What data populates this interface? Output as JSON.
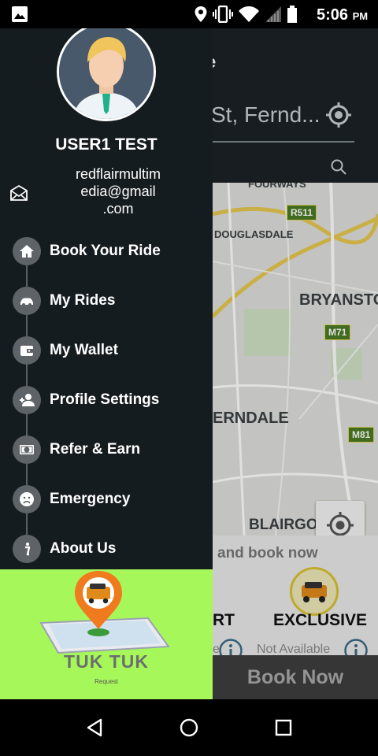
{
  "status_bar": {
    "time": "5:06",
    "ampm": "PM",
    "icons": [
      "gallery-icon",
      "location-icon",
      "vibrate-icon",
      "wifi-icon",
      "signal-icon",
      "battery-icon"
    ]
  },
  "background_screen": {
    "header_title": "e",
    "address": "St, Fernd...",
    "map_labels": {
      "fourways": "FOURWAYS",
      "douglasdale": "DOUGLASDALE",
      "bryanston": "BRYANSTO",
      "ferndale": "ERNDALE",
      "blairgowrie": "BLAIRGOWRIE",
      "r511": "R511",
      "m71": "M71",
      "m81": "M81"
    },
    "hint": "and book now",
    "options": [
      {
        "label": "RT",
        "availability": "e"
      },
      {
        "label": "EXCLUSIVE",
        "availability": "Not Available"
      }
    ],
    "book_button": "Book Now"
  },
  "drawer": {
    "user_name": "USER1 TEST",
    "email_lines": [
      "redflairmultim",
      "edia@gmail",
      ".com"
    ],
    "menu": [
      {
        "label": "Book Your Ride",
        "icon": "home-icon"
      },
      {
        "label": "My Rides",
        "icon": "car-icon"
      },
      {
        "label": "My Wallet",
        "icon": "wallet-icon"
      },
      {
        "label": "Profile Settings",
        "icon": "add-user-icon"
      },
      {
        "label": "Refer & Earn",
        "icon": "money-icon"
      },
      {
        "label": "Emergency",
        "icon": "sad-face-icon"
      },
      {
        "label": "About Us",
        "icon": "info-icon"
      }
    ],
    "promo": {
      "brand": "TUK TUK",
      "sub": "Request"
    }
  },
  "colors": {
    "drawer_bg": "#151c20",
    "menu_circle": "#5e6367",
    "promo_bg": "#a6f85a",
    "pin_orange": "#f07a1e"
  }
}
